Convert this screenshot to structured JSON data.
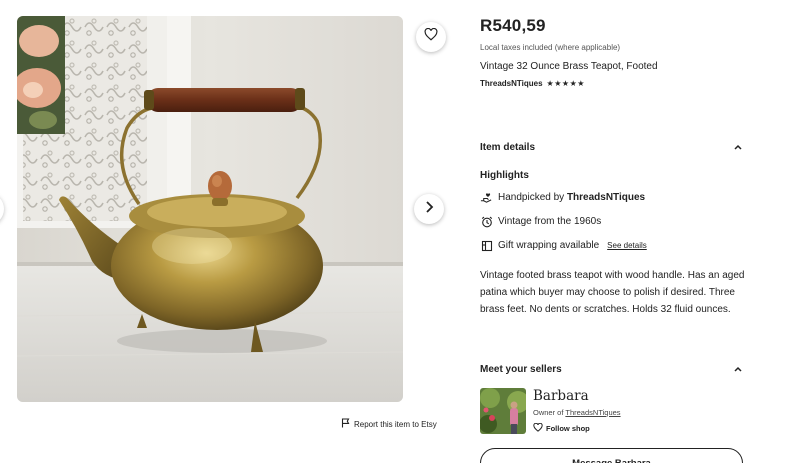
{
  "gallery": {
    "image_alt": "Vintage brass teapot with wooden handle on a white shelf",
    "report_label": "Report this item to Etsy"
  },
  "listing": {
    "price": "R540,59",
    "tax_note": "Local taxes included (where applicable)",
    "title": "Vintage 32 Ounce Brass Teapot, Footed",
    "shop_name": "ThreadsNTiques",
    "rating_stars": "★★★★★",
    "rating_value": 5
  },
  "item_details": {
    "heading": "Item details",
    "highlights_heading": "Highlights",
    "handpicked_prefix": "Handpicked by ",
    "handpicked_shop": "ThreadsNTiques",
    "vintage_label": "Vintage from the 1960s",
    "gift_label": "Gift wrapping available",
    "see_details": "See details",
    "description": "Vintage footed brass teapot with wood handle. Has an aged patina which buyer may choose to polish if desired. Three brass feet. No dents or scratches. Holds 32 fluid ounces."
  },
  "sellers": {
    "heading": "Meet your sellers",
    "name": "Barbara",
    "owner_prefix": "Owner of ",
    "owner_shop": "ThreadsNTiques",
    "follow_label": "Follow shop",
    "message_button": "Message Barbara"
  },
  "icons": {
    "favorite": "heart-icon",
    "next": "chevron-right-icon",
    "prev": "chevron-left-icon",
    "report": "flag-icon",
    "collapse": "chevron-up-icon",
    "handpicked": "hand-heart-icon",
    "vintage": "clock-icon",
    "gift": "gift-box-icon",
    "follow": "heart-outline-icon"
  }
}
